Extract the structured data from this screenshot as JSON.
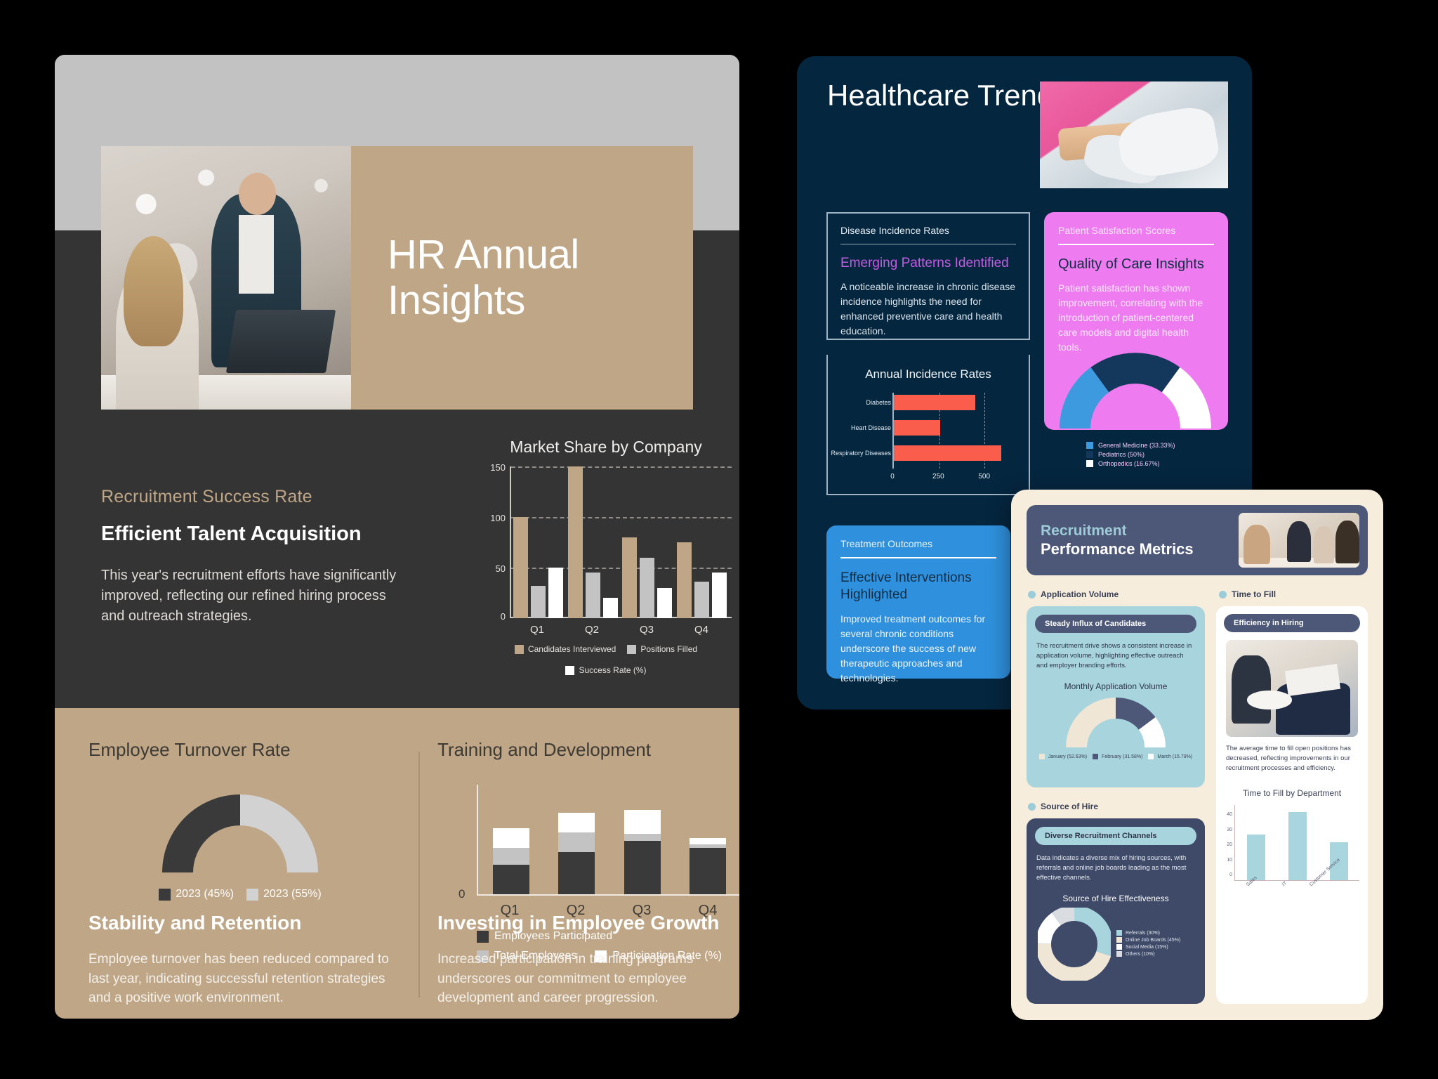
{
  "slide1": {
    "title": "HR Annual Insights",
    "eyebrow": "Recruitment Success Rate",
    "heading": "Efficient Talent Acquisition",
    "body": "This year's recruitment efforts have significantly improved, reflecting our refined hiring process and outreach strategies.",
    "turnover_label": "Employee Turnover Rate",
    "training_label": "Training and Development",
    "foot_left_head": "Stability and Retention",
    "foot_left_body": "Employee turnover has been reduced compared to last year, indicating successful retention strategies and a positive work environment.",
    "foot_right_head": "Investing in Employee Growth",
    "foot_right_body": "Increased participation in training programs underscores our commitment to employee development and career progression.",
    "colors": {
      "tan": "#bfa687",
      "dark": "#343434",
      "gray": "#c2c2c2",
      "white": "#ffffff"
    }
  },
  "slide2": {
    "title": "Healthcare Trends Overview",
    "disease_card": {
      "label": "Disease Incidence Rates",
      "kicker": "Emerging Patterns Identified",
      "text": "A noticeable increase in chronic disease incidence highlights the need for enhanced preventive care and health education."
    },
    "satisfaction_card": {
      "label": "Patient Satisfaction Scores",
      "heading": "Quality of Care Insights",
      "text": "Patient satisfaction has shown improvement, correlating with the introduction of patient-centered care models and digital health tools."
    },
    "treatment_card": {
      "label": "Treatment Outcomes",
      "heading": "Effective Interventions Highlighted",
      "text": "Improved treatment outcomes for several chronic conditions underscore the success of new therapeutic approaches and technologies."
    },
    "colors": {
      "navy": "#05263f",
      "pink": "#ee7cf0",
      "blue": "#2f91dd",
      "coral": "#fa5d4b",
      "purple": "#c25ce0"
    }
  },
  "slide3": {
    "h1": "Recruitment",
    "h2": "Performance Metrics",
    "sections": {
      "application_volume": "Application Volume",
      "time_to_fill": "Time to Fill",
      "source_of_hire": "Source of Hire"
    },
    "app_card": {
      "pill": "Steady Influx of Candidates",
      "text": "The recruitment drive shows a consistent increase in application volume, highlighting effective outreach and employer branding efforts."
    },
    "ttf_card": {
      "pill": "Efficiency in Hiring",
      "text": "The average time to fill open positions has decreased, reflecting improvements in our recruitment processes and efficiency."
    },
    "soh_card": {
      "pill": "Diverse Recruitment Channels",
      "text": "Data indicates a diverse mix of hiring sources, with referrals and online job boards leading as the most effective channels."
    },
    "colors": {
      "cream": "#f6eddc",
      "slate": "#4d5878",
      "teal": "#a9d5de",
      "lightblue": "#a7d4dd"
    }
  },
  "chart_data": [
    {
      "id": "market_share",
      "type": "bar",
      "title": "Market Share by Company",
      "categories": [
        "Q1",
        "Q2",
        "Q3",
        "Q4"
      ],
      "series": [
        {
          "name": "Candidates Interviewed",
          "color": "#bfa687",
          "values": [
            100,
            150,
            80,
            75
          ]
        },
        {
          "name": "Positions Filled",
          "color": "#c3c3c3",
          "values": [
            32,
            45,
            60,
            36
          ]
        },
        {
          "name": "Success Rate (%)",
          "color": "#ffffff",
          "values": [
            50,
            20,
            30,
            45
          ]
        }
      ],
      "ylim": [
        0,
        160
      ],
      "yticks": [
        0,
        50,
        100,
        150
      ],
      "grid": true,
      "legend": "bottom"
    },
    {
      "id": "employee_turnover",
      "type": "pie",
      "title": "Employee Turnover Rate",
      "variant": "half-donut",
      "labels": [
        "2023 (45%)",
        "2023 (55%)"
      ],
      "values": [
        45,
        55
      ],
      "colors": [
        "#3a3a3a",
        "#d2d2d2"
      ],
      "legend": "bottom"
    },
    {
      "id": "training_development",
      "type": "bar",
      "variant": "stacked",
      "title": "Training and Development",
      "categories": [
        "Q1",
        "Q2",
        "Q3",
        "Q4"
      ],
      "series": [
        {
          "name": "Employees Participated",
          "color": "#3a3a3a",
          "values": [
            42,
            60,
            76,
            66
          ]
        },
        {
          "name": "Total Employees",
          "color": "#c3c3c3",
          "values": [
            24,
            28,
            10,
            5
          ]
        },
        {
          "name": "Participation Rate (%)",
          "color": "#ffffff",
          "values": [
            28,
            28,
            34,
            9
          ]
        }
      ],
      "yticks": [
        0
      ],
      "legend": "bottom"
    },
    {
      "id": "annual_incidence",
      "type": "bar",
      "variant": "horizontal",
      "title": "Annual Incidence Rates",
      "categories": [
        "Diabetes",
        "Heart Disease",
        "Respiratory Diseases"
      ],
      "values": [
        440,
        255,
        590
      ],
      "color": "#fa5d4b",
      "xticks": [
        0,
        250,
        500
      ],
      "xlim": [
        0,
        650
      ],
      "grid": true
    },
    {
      "id": "care_distribution",
      "type": "pie",
      "variant": "half-donut",
      "labels": [
        "General Medicine (33.33%)",
        "Pediatrics (50%)",
        "Orthopedics (16.67%)"
      ],
      "values": [
        33.33,
        50,
        16.67
      ],
      "colors": [
        "#3d9ade",
        "#14385c",
        "#ffffff"
      ],
      "legend": "bottom"
    },
    {
      "id": "monthly_application_volume",
      "type": "pie",
      "variant": "half-donut",
      "title": "Monthly Application Volume",
      "labels": [
        "January (52.63%)",
        "February (31.58%)",
        "March (15.79%)"
      ],
      "values": [
        52.63,
        31.58,
        15.79
      ],
      "colors": [
        "#f0e6d5",
        "#4d5878",
        "#ffffff"
      ],
      "legend": "bottom"
    },
    {
      "id": "time_to_fill_by_department",
      "type": "bar",
      "title": "Time to Fill by Department",
      "categories": [
        "Sales",
        "IT",
        "Customer Service"
      ],
      "values": [
        30,
        45,
        25
      ],
      "color": "#a9d5de",
      "ylim": [
        0,
        50
      ],
      "yticks": [
        0,
        10,
        20,
        30,
        40
      ]
    },
    {
      "id": "source_of_hire_effectiveness",
      "type": "pie",
      "variant": "donut",
      "title": "Source of Hire Effectiveness",
      "labels": [
        "Referrals (30%)",
        "Online Job Boards (45%)",
        "Social Media (15%)",
        "Others (10%)"
      ],
      "values": [
        30,
        45,
        15,
        10
      ],
      "colors": [
        "#a7d4dd",
        "#f0e6d5",
        "#ffffff",
        "#d9dde2"
      ],
      "legend": "right"
    }
  ]
}
